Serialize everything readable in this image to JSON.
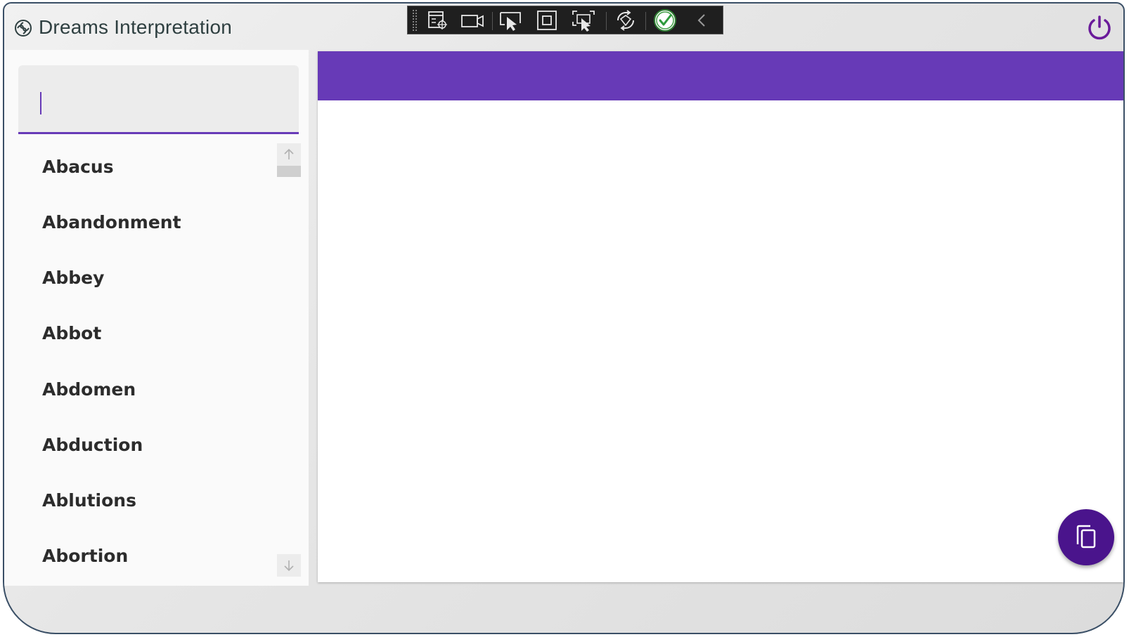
{
  "window": {
    "title": "Dreams Interpretation"
  },
  "colors": {
    "accent": "#673ab7",
    "fab": "#4a148c",
    "power": "#6a1b9a"
  },
  "search": {
    "value": "",
    "placeholder": ""
  },
  "list": {
    "items": [
      {
        "label": "Abacus"
      },
      {
        "label": "Abandonment"
      },
      {
        "label": "Abbey"
      },
      {
        "label": "Abbot"
      },
      {
        "label": "Abdomen"
      },
      {
        "label": "Abduction"
      },
      {
        "label": "Ablutions"
      },
      {
        "label": "Abortion"
      }
    ]
  },
  "devtoolbar": {
    "icons": [
      "select-element-icon",
      "record-video-icon",
      "select-pointer-icon",
      "display-layout-adorners-icon",
      "track-focused-element-icon",
      "hot-reload-icon",
      "hot-reload-status-icon",
      "collapse-toolbar-icon"
    ]
  },
  "fab": {
    "icon": "copy-icon"
  }
}
